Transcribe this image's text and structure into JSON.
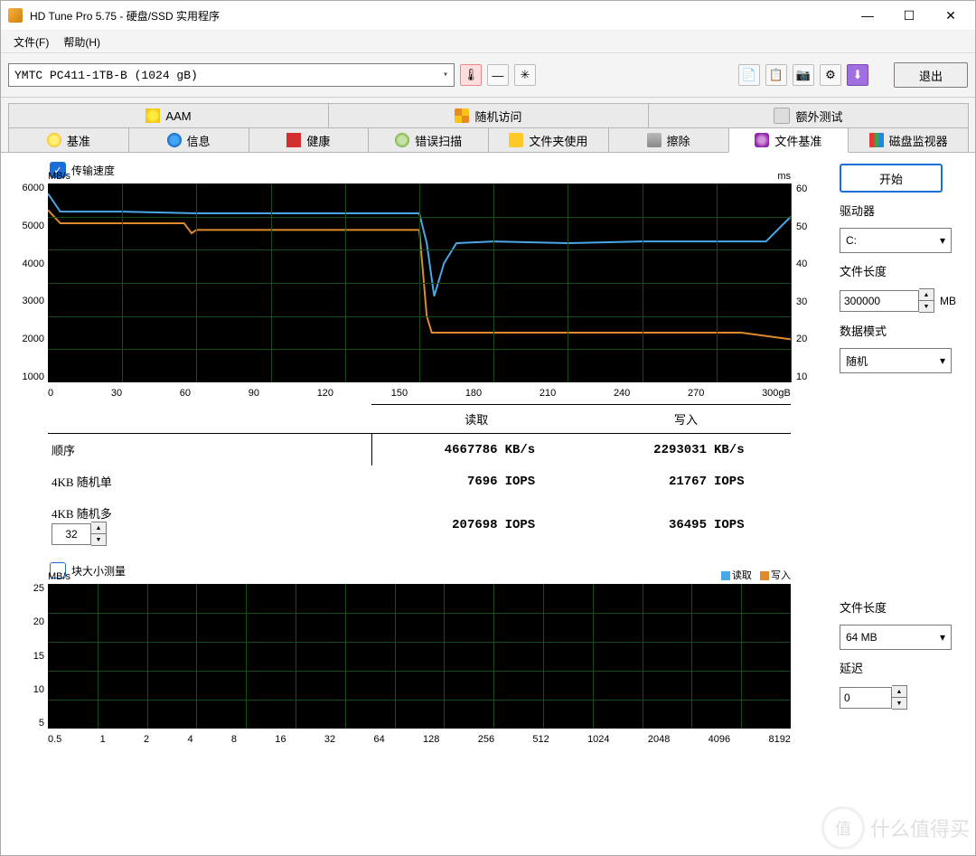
{
  "window": {
    "title": "HD Tune Pro 5.75 - 硬盘/SSD 实用程序"
  },
  "menu": {
    "file": "文件(F)",
    "help": "帮助(H)"
  },
  "toolbar": {
    "device": "YMTC PC411-1TB-B (1024 gB)",
    "exit": "退出"
  },
  "tabs_row1": {
    "aam": "AAM",
    "random": "随机访问",
    "extra": "额外测试"
  },
  "tabs_row2": {
    "bench": "基准",
    "info": "信息",
    "health": "健康",
    "errscan": "错误扫描",
    "folder": "文件夹使用",
    "erase": "擦除",
    "filebench": "文件基准",
    "monitor": "磁盘监视器"
  },
  "filebench": {
    "checkbox_label": "传输速度",
    "start_btn": "开始",
    "drive_label": "驱动器",
    "drive_value": "C:",
    "filelen_label": "文件长度",
    "filelen_value": "300000",
    "filelen_unit": "MB",
    "datamode_label": "数据模式",
    "datamode_value": "随机",
    "axis_y_label": "MB/s",
    "axis_y2_label": "ms",
    "x_unit": "gB"
  },
  "chart_data": {
    "type": "line",
    "x_range": [
      0,
      300
    ],
    "y_range": [
      0,
      6000
    ],
    "y2_range": [
      0,
      60
    ],
    "y_label": "MB/s",
    "y2_label": "ms",
    "x_ticks": [
      0,
      30,
      60,
      90,
      120,
      150,
      180,
      210,
      240,
      270,
      300
    ],
    "y_ticks": [
      1000,
      2000,
      3000,
      4000,
      5000,
      6000
    ],
    "y2_ticks": [
      10,
      20,
      30,
      40,
      50,
      60
    ],
    "series": [
      {
        "name": "读取",
        "color": "#4aa8e8",
        "values_approx": [
          [
            0,
            5700
          ],
          [
            5,
            5150
          ],
          [
            30,
            5150
          ],
          [
            60,
            5100
          ],
          [
            90,
            5100
          ],
          [
            120,
            5100
          ],
          [
            150,
            5100
          ],
          [
            153,
            4200
          ],
          [
            156,
            2600
          ],
          [
            160,
            3600
          ],
          [
            165,
            4200
          ],
          [
            180,
            4250
          ],
          [
            210,
            4200
          ],
          [
            240,
            4250
          ],
          [
            270,
            4250
          ],
          [
            290,
            4250
          ],
          [
            300,
            5000
          ]
        ]
      },
      {
        "name": "写入",
        "color": "#e08a2c",
        "values_approx": [
          [
            0,
            5200
          ],
          [
            5,
            4800
          ],
          [
            30,
            4800
          ],
          [
            55,
            4800
          ],
          [
            58,
            4500
          ],
          [
            60,
            4600
          ],
          [
            90,
            4600
          ],
          [
            120,
            4600
          ],
          [
            150,
            4600
          ],
          [
            153,
            2000
          ],
          [
            155,
            1500
          ],
          [
            180,
            1500
          ],
          [
            210,
            1500
          ],
          [
            240,
            1500
          ],
          [
            270,
            1500
          ],
          [
            280,
            1500
          ],
          [
            300,
            1300
          ]
        ]
      }
    ]
  },
  "results": {
    "header_read": "读取",
    "header_write": "写入",
    "rows": [
      {
        "label": "顺序",
        "read_val": "4667786",
        "read_unit": "KB/s",
        "write_val": "2293031",
        "write_unit": "KB/s"
      },
      {
        "label": "4KB 随机单",
        "read_val": "7696",
        "read_unit": "IOPS",
        "write_val": "21767",
        "write_unit": "IOPS"
      },
      {
        "label": "4KB 随机多",
        "spin": "32",
        "read_val": "207698",
        "read_unit": "IOPS",
        "write_val": "36495",
        "write_unit": "IOPS"
      }
    ]
  },
  "blocksize": {
    "checkbox_label": "块大小测量",
    "axis_y_label": "MB/s",
    "legend_read": "读取",
    "legend_write": "写入",
    "filelen_label": "文件长度",
    "filelen_value": "64 MB",
    "delay_label": "延迟",
    "delay_value": "0"
  },
  "chart_data_block": {
    "type": "line",
    "x_ticks": [
      "0.5",
      "1",
      "2",
      "4",
      "8",
      "16",
      "32",
      "64",
      "128",
      "256",
      "512",
      "1024",
      "2048",
      "4096",
      "8192"
    ],
    "y_ticks": [
      5,
      10,
      15,
      20,
      25
    ],
    "y_range": [
      0,
      25
    ],
    "series": []
  },
  "watermark": {
    "text": "什么值得买",
    "badge": "值"
  }
}
